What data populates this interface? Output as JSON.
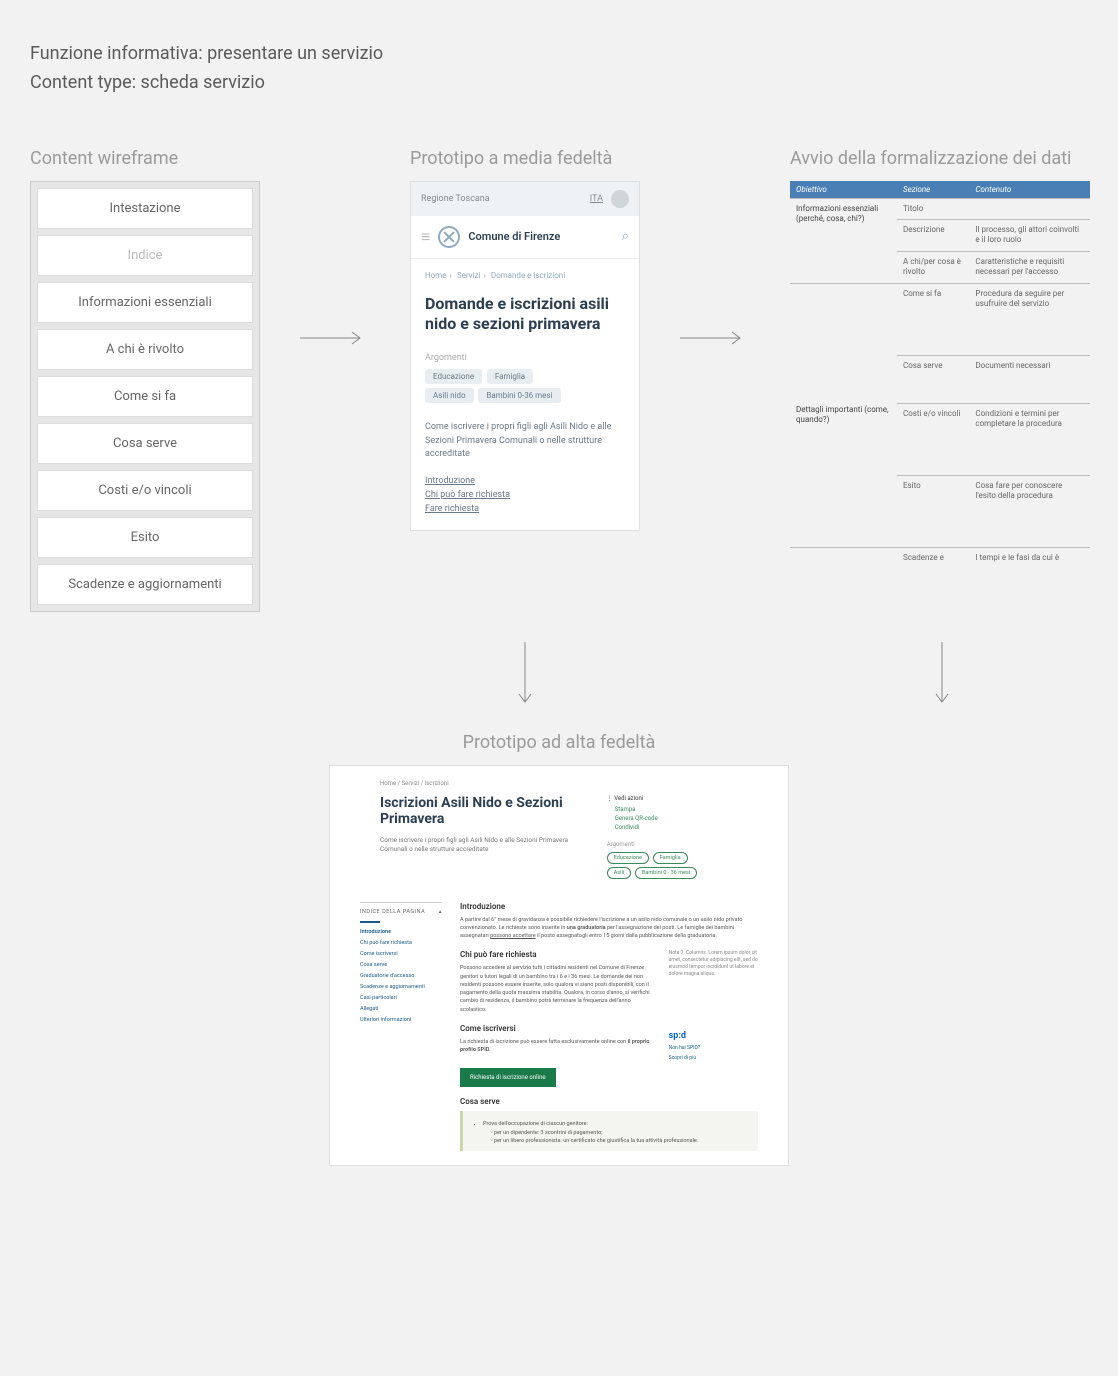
{
  "header": {
    "line1": "Funzione informativa: presentare un servizio",
    "line2": "Content type: scheda servizio"
  },
  "labels": {
    "wireframe": "Content wireframe",
    "midfi": "Prototipo a media fedeltà",
    "formal": "Avvio della formalizzazione dei dati",
    "hifi": "Prototipo ad alta fedeltà"
  },
  "wireframe": {
    "items": [
      "Intestazione",
      "Indice",
      "Informazioni essenziali",
      "A chi è rivolto",
      "Come si fa",
      "Cosa serve",
      "Costi e/o vincoli",
      "Esito",
      "Scadenze e aggiornamenti"
    ]
  },
  "midfi": {
    "region": "Regione Toscana",
    "lang": "ITA",
    "comune": "Comune di Firenze",
    "breadcrumb": {
      "a": "Home",
      "b": "Servizi",
      "c": "Domande e iscrizioni"
    },
    "title": "Domande e iscrizioni asili nido e sezioni primavera",
    "argomenti_label": "Argomenti",
    "pills": [
      "Educazione",
      "Famiglia",
      "Asili nido",
      "Bambini 0-36 mesi"
    ],
    "desc": "Come iscrivere i propri figli agli Asili Nido e alle Sezioni Primavera Comunali o nelle strutture accreditate",
    "links": [
      "Introduzione",
      "Chi può fare richiesta",
      "Fare richiesta"
    ]
  },
  "table": {
    "headers": {
      "a": "Obiettivo",
      "b": "Sezione",
      "c": "Contenuto"
    },
    "rows": [
      {
        "obj": "",
        "sec": "Titolo",
        "con": ""
      },
      {
        "obj": "Informazioni essenziali (perché, cosa, chi?)",
        "sec": "Descrizione",
        "con": "Il processo, gli attori coinvolti e il loro ruolo"
      },
      {
        "obj": "",
        "sec": "A chi/per cosa è rivolto",
        "con": "Caratteristiche e requisiti necessari per l'accesso"
      },
      {
        "obj": "",
        "sec": "Come si fa",
        "con": "Procedura da seguire per usufruire del servizio"
      },
      {
        "obj": "",
        "sec": "Cosa serve",
        "con": "Documenti necessari"
      },
      {
        "obj": "Dettagli importanti (come, quando?)",
        "sec": "Costi e/o vincoli",
        "con": "Condizioni e termini per completare la procedura"
      },
      {
        "obj": "",
        "sec": "Esito",
        "con": "Cosa fare per conoscere l'esito della procedura"
      },
      {
        "obj": "",
        "sec": "Scadenze e",
        "con": "I tempi e le fasi da cui è"
      }
    ]
  },
  "hifi": {
    "breadcrumb": "Home / Servizi / Iscrizioni",
    "title": "Iscrizioni Asili Nido e Sezioni Primavera",
    "sub": "Come iscrivere i propri figli agli Asili Nido e alle Sezioni Primavera Comunali o nelle strutture accreditate",
    "actions_label": "Vedi azioni",
    "actions": [
      "Stampa",
      "Genera QR-code",
      "Condividi"
    ],
    "argo_label": "Argomenti",
    "pills": [
      "Educazione",
      "Famiglia",
      "Asili",
      "Bambini 0 - 36 mesi"
    ],
    "nav_title": "INDICE DELLA PAGINA",
    "nav": [
      "Introduzione",
      "Chi può fare richiesta",
      "Come iscriversi",
      "Cosa serve",
      "Graduatorie d'accesso",
      "Scadenze e aggiornamenti",
      "Casi particolari",
      "Allegati",
      "Ulteriori informazioni"
    ],
    "sec1_h": "Introduzione",
    "sec1_p": "A partire dal 6° mese di gravidanza è possibile richiedere l'iscrizione a un asilo nido comunale o un asilo nido privato convenzionato. Le richieste sono inserite in una graduatoria per l'assegnazione dei posti. Le famiglie dei bambini assegnatari possono accettare il posto assegnatogli entro 15 giorni dalla pubblicazione della graduatoria.",
    "sec2_h": "Chi può fare richiesta",
    "sec2_p": "Possono accedere al servizio tutti i cittadini residenti nel Comune di Firenze genitori o tutori legali di un bambino tra i 6 e i 36 mesi. Le domande dei non residenti possono essere inserite, solo qualora vi siano posti disponibili, con il pagamento della quota massima stabilita. Qualora, in corso d'anno, si verifichi cambio di residenza, il bambino potrà terminare la frequenza dell'anno scolastico.",
    "sec2_note": "Nota 2. Columns. Lorem ipsum dolor sit amet, consectetur adipiscing elit, sed do eiusmod tempor incididunt ut labore et dolore magna aliqua.",
    "sec3_h": "Come iscriversi",
    "sec3_p1": "La richiesta di iscrizione può essere fatta esclusivamente online con ",
    "sec3_p2": "il proprio profilo SPID.",
    "spid_link1": "Non hai SPID?",
    "spid_link2": "Scopri di più",
    "btn": "Richiesta di iscrizione online",
    "sec4_h": "Cosa serve",
    "sec4_intro": "Prova dell'occupazione di ciascun genitore:",
    "sec4_li1": "- per un dipendente: 3 scontrini di pagamento;",
    "sec4_li2": "- per un libero professionista: un certificato che giustifica la tua attività professionale."
  }
}
